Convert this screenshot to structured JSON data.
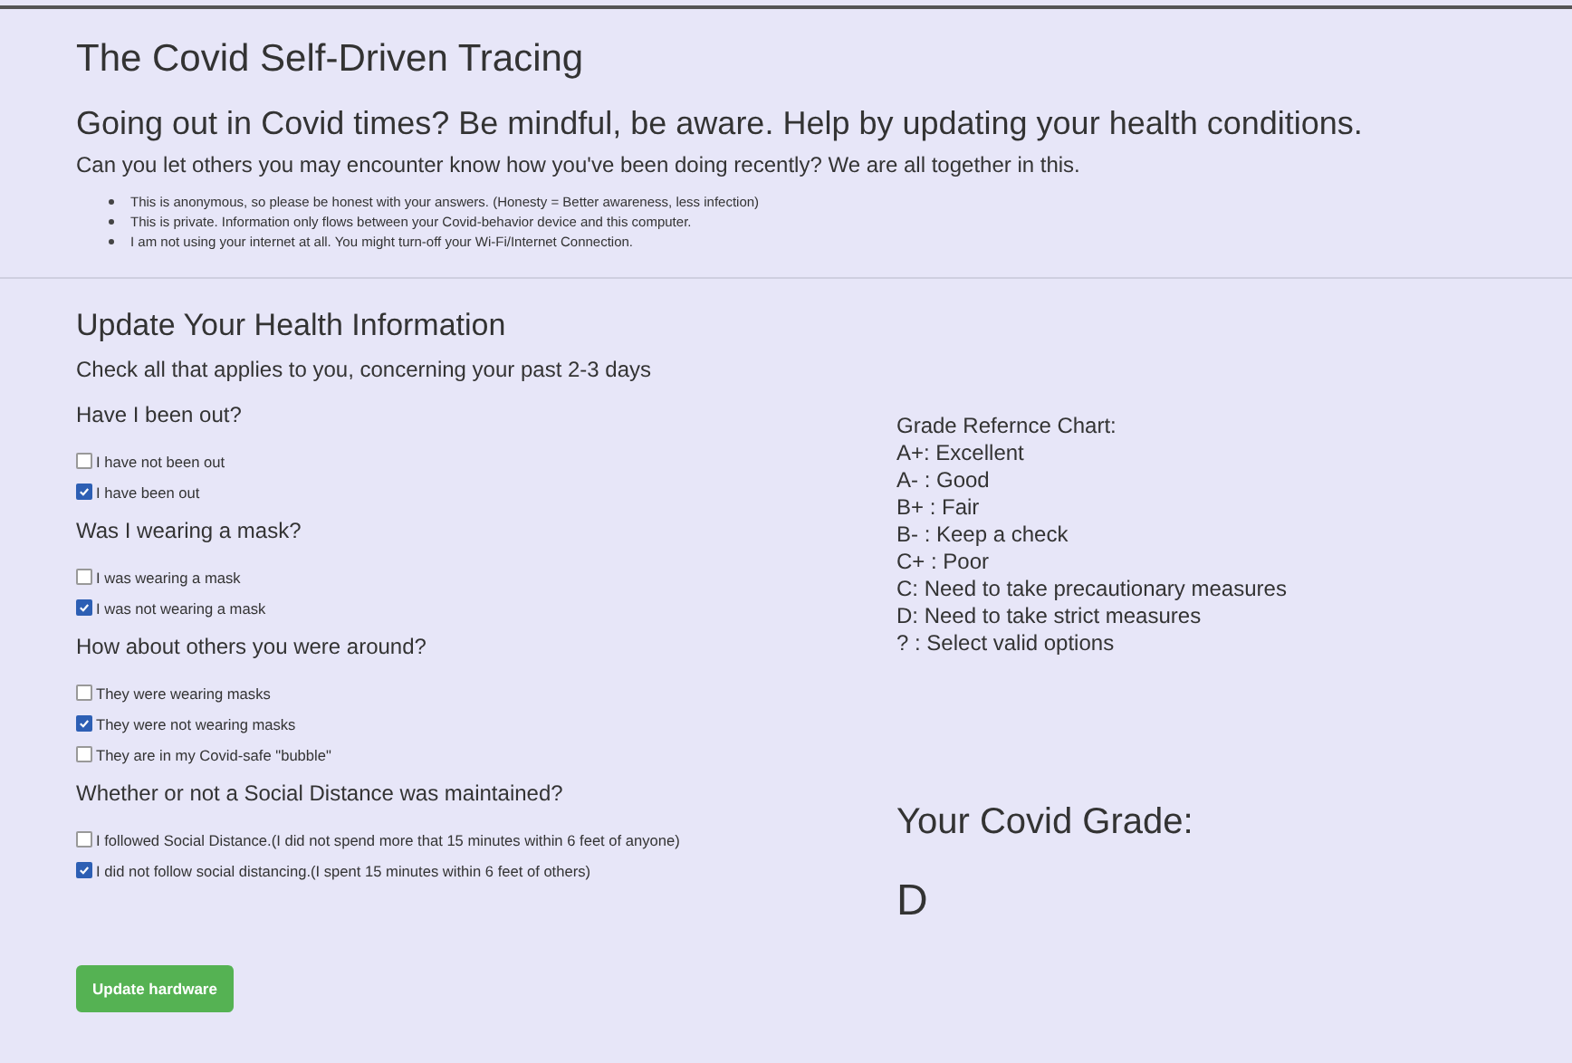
{
  "title": "The Covid Self-Driven Tracing",
  "subtitle": "Going out in Covid times? Be mindful, be aware. Help by updating your health conditions.",
  "intro": "Can you let others you may encounter know how you've been doing recently? We are all together in this.",
  "notes": [
    "This is anonymous, so please be honest with your answers. (Honesty = Better awareness, less infection)",
    "This is private. Information only flows between your Covid-behavior device and this computer.",
    "I am not using your internet at all. You might turn-off your Wi-Fi/Internet Connection."
  ],
  "form": {
    "heading": "Update Your Health Information",
    "instruction": "Check all that applies to you, concerning your past 2-3 days",
    "questions": [
      {
        "question": "Have I been out?",
        "options": [
          {
            "label": "I have not been out",
            "checked": false
          },
          {
            "label": "I have been out",
            "checked": true
          }
        ]
      },
      {
        "question": "Was I wearing a mask?",
        "options": [
          {
            "label": "I was wearing a mask",
            "checked": false
          },
          {
            "label": "I was not wearing a mask",
            "checked": true
          }
        ]
      },
      {
        "question": "How about others you were around?",
        "options": [
          {
            "label": "They were wearing masks",
            "checked": false
          },
          {
            "label": "They were not wearing masks",
            "checked": true
          },
          {
            "label": "They are in my Covid-safe \"bubble\"",
            "checked": false
          }
        ]
      },
      {
        "question": "Whether or not a Social Distance was maintained?",
        "options": [
          {
            "label": "I followed Social Distance.(I did not spend more that 15 minutes within 6 feet of anyone)",
            "checked": false
          },
          {
            "label": "I did not follow social distancing.(I spent 15 minutes within 6 feet of others)",
            "checked": true
          }
        ]
      }
    ],
    "button": "Update hardware"
  },
  "reference": {
    "title": "Grade Refernce Chart:",
    "lines": [
      "A+: Excellent",
      "A- : Good",
      "B+ : Fair",
      "B- : Keep a check",
      "C+ : Poor",
      "C: Need to take precautionary measures",
      "D: Need to take strict measures",
      "? : Select valid options"
    ]
  },
  "grade": {
    "label": "Your Covid Grade:",
    "value": "D"
  }
}
